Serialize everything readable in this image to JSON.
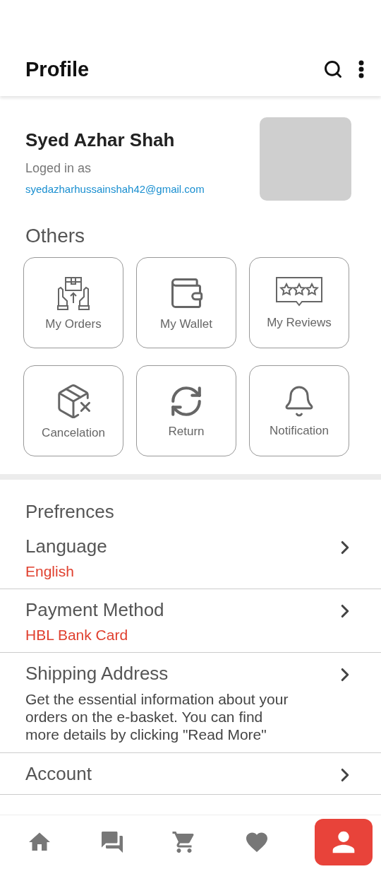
{
  "app_bar": {
    "title": "Profile"
  },
  "user": {
    "name": "Syed Azhar Shah",
    "status": "Loged in as",
    "email": "syedazharhussainshah42@gmail.com"
  },
  "others": {
    "heading": "Others",
    "tiles": [
      {
        "kind": "orders",
        "label": "My Orders"
      },
      {
        "kind": "wallet",
        "label": "My Wallet"
      },
      {
        "kind": "reviews",
        "label": "My Reviews"
      },
      {
        "kind": "cancel",
        "label": "Cancelation"
      },
      {
        "kind": "return",
        "label": "Return"
      },
      {
        "kind": "bell",
        "label": "Notification"
      }
    ]
  },
  "preferences": {
    "heading": "Prefrences",
    "rows": [
      {
        "kind": "value",
        "title": "Language",
        "detail": "English"
      },
      {
        "kind": "value",
        "title": "Payment Method",
        "detail": "HBL Bank Card"
      },
      {
        "kind": "description",
        "title": "Shipping Address",
        "detail": "Get the essential information about your orders on the e-basket. You can find more details by clicking \"Read More\""
      },
      {
        "kind": "plain",
        "title": "Account"
      }
    ]
  },
  "bottom_nav": [
    {
      "kind": "home",
      "selected": false
    },
    {
      "kind": "chat",
      "selected": false
    },
    {
      "kind": "cart",
      "selected": false
    },
    {
      "kind": "favorite",
      "selected": false
    },
    {
      "kind": "profile",
      "selected": true
    }
  ]
}
